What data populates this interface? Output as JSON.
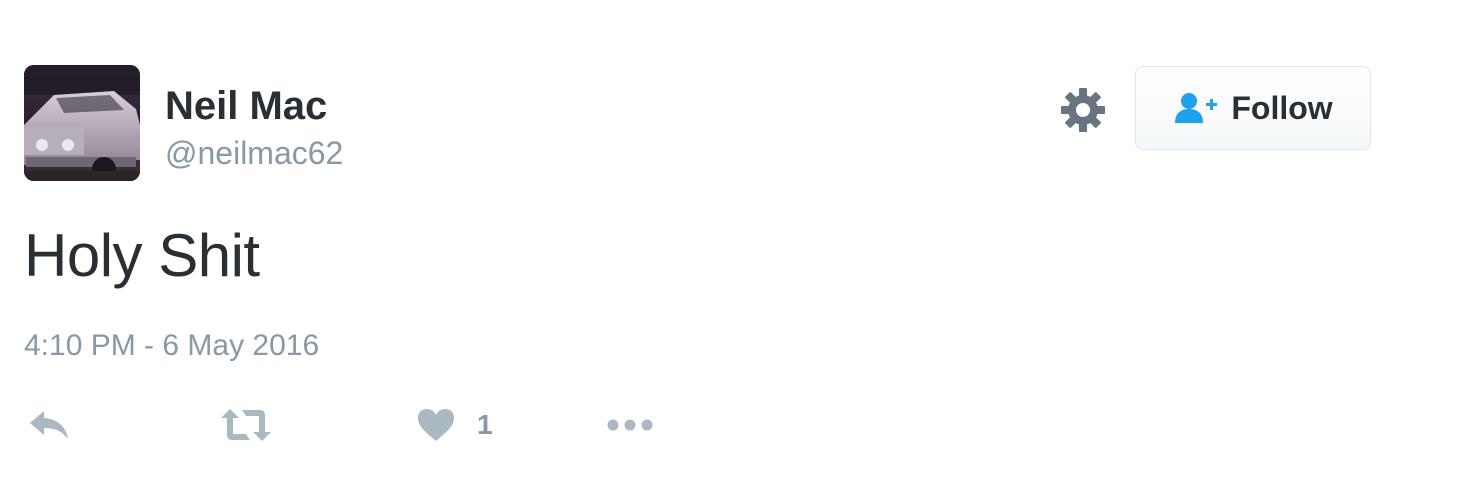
{
  "user": {
    "name": "Neil Mac",
    "handle": "@neilmac62",
    "avatar_icon": "avatar-car-photo"
  },
  "header_actions": {
    "settings_icon": "gear-icon",
    "follow_label": "Follow",
    "follow_icon": "add-user-icon"
  },
  "tweet": {
    "text": "Holy Shit",
    "timestamp": "4:10 PM - 6 May 2016"
  },
  "actions": {
    "reply_icon": "reply-icon",
    "retweet_icon": "retweet-icon",
    "like_icon": "heart-icon",
    "like_count": "1",
    "more_icon": "more-dots-icon"
  },
  "colors": {
    "text_primary": "#292f33",
    "text_secondary": "#8899a6",
    "icon_gray": "#aab8c2",
    "gear_gray": "#66757f",
    "follow_icon_blue": "#1da1f2",
    "button_border": "#e1e8ed"
  }
}
